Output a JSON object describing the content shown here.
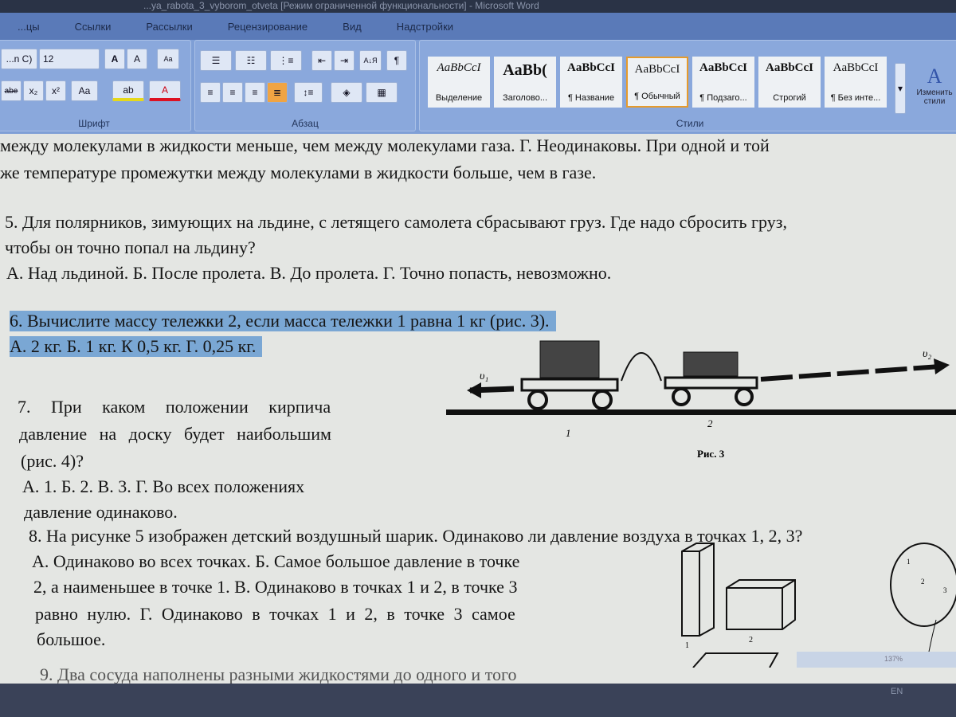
{
  "window": {
    "title": "...ya_rabota_3_vyborom_otveta [Режим ограниченной функциональности] - Microsoft Word"
  },
  "tabs": [
    "...цы",
    "Ссылки",
    "Рассылки",
    "Рецензирование",
    "Вид",
    "Надстройки"
  ],
  "ribbon": {
    "font": {
      "name": "...n C)",
      "size": "12",
      "label": "Шрифт",
      "grow": "A",
      "shrink": "A",
      "clear": "Aa",
      "strike": "abe",
      "sub": "x₂",
      "sup": "x²",
      "case": "Aa",
      "highlight": "ab",
      "color": "A"
    },
    "paragraph": {
      "label": "Абзац",
      "pilcrow": "¶",
      "sort": "А↓Я"
    },
    "styles": {
      "label": "Стили",
      "items": [
        {
          "sample": "AaBbCcI",
          "name": "Выделение"
        },
        {
          "sample": "AaBb(",
          "name": "Заголово..."
        },
        {
          "sample": "AaBbCcI",
          "name": "¶ Название"
        },
        {
          "sample": "AaBbCcI",
          "name": "¶ Обычный"
        },
        {
          "sample": "AaBbCcI",
          "name": "¶ Подзаго..."
        },
        {
          "sample": "AaBbCcI",
          "name": "Строгий"
        },
        {
          "sample": "AaBbCcI",
          "name": "¶ Без инте..."
        }
      ],
      "change": "Изменить стили"
    }
  },
  "document": {
    "lines": [
      "между молекулами в жидкости меньше, чем между молекулами газа. Г. Неодинаковы. При одной и той",
      "же температуре промежутки между молекулами в жидкости больше, чем в газе.",
      "5. Для полярников, зимующих на льдине, с летящего самолета сбрасывают груз. Где надо сбросить груз,",
      "чтобы он точно попал на льдину?",
      "А. Над льдиной. Б. После пролета. В. До пролета. Г. Точно попасть, невозможно.",
      "6. Вычислите массу тележки 2, если масса тележки 1 равна 1 кг (рис. 3).",
      "А. 2 кг. Б. 1 кг. К 0,5 кг. Г. 0,25 кг.",
      "7. При каком положении кирпича",
      "давление на доску будет наибольшим",
      "(рис. 4)?",
      "А. 1. Б. 2. В. 3. Г. Во всех положениях",
      "давление одинаково.",
      "8. На рисунке 5 изображен детский воздушный шарик. Одинаково ли давление воздуха в точках 1, 2, 3?",
      "А. Одинаково во всех точках. Б. Самое большое давление в точке",
      "2, а наименьшее в точке 1. В. Одинаково в точках 1 и 2, в точке 3",
      "равно нулю. Г. Одинаково в точках 1 и 2, в точке 3 самое",
      "большое.",
      "9. Два сосуда наполнены разными жидкостями до одного и того"
    ],
    "fig3": {
      "caption": "Рис. 3",
      "cart1": "1",
      "cart2": "2",
      "v1": "υ₁",
      "v2": "υ₂"
    },
    "fig4": {
      "label1": "1",
      "label2": "2"
    },
    "fig5": {
      "p1": "1",
      "p2": "2",
      "p3": "3"
    }
  },
  "status": {
    "zoom": "137%",
    "lang": "EN"
  }
}
